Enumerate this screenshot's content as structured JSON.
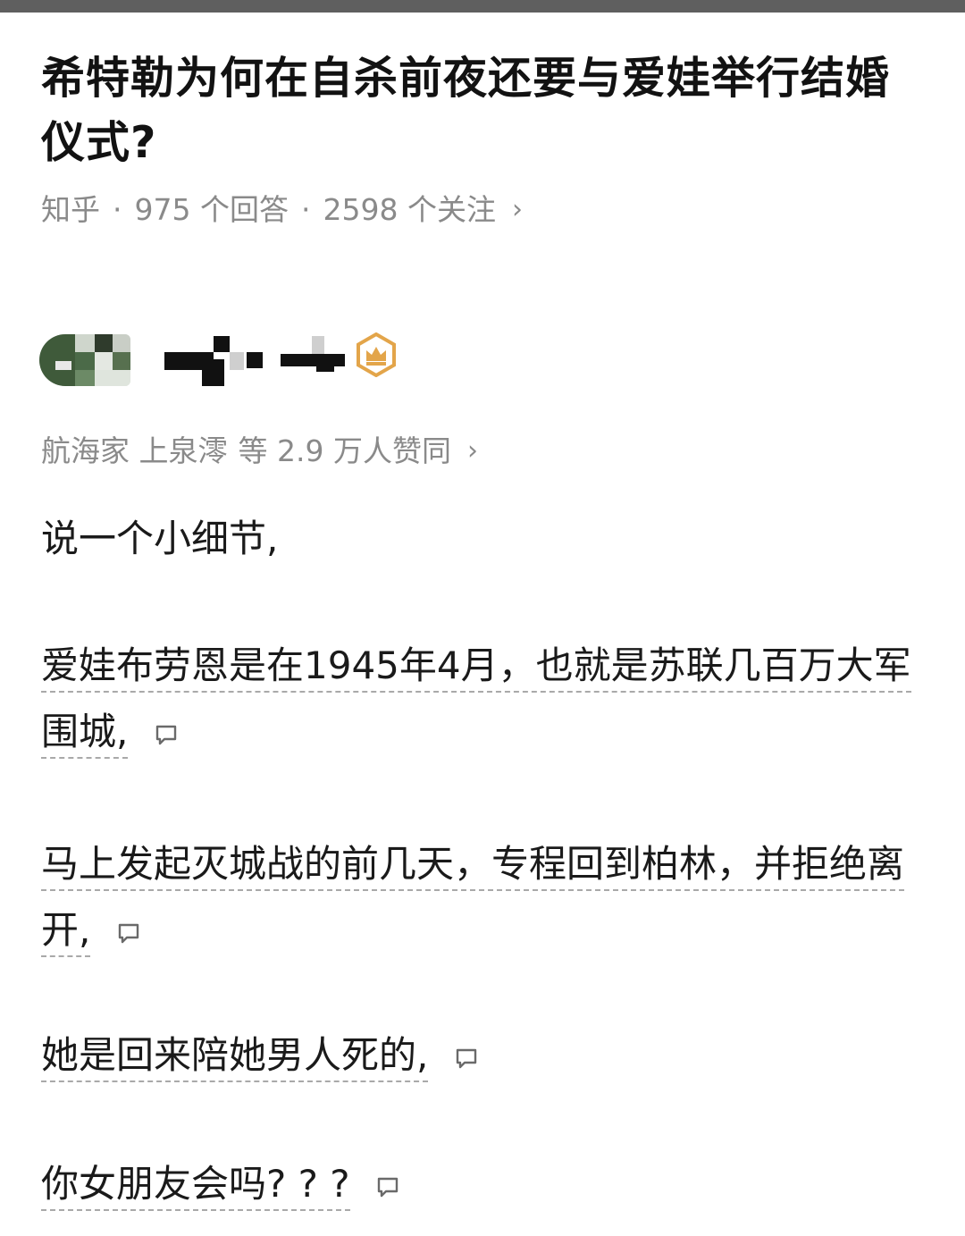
{
  "question": {
    "title": "希特勒为何在自杀前夜还要与爱娃举行结婚仪式?",
    "source": "知乎",
    "answers": "975 个回答",
    "followers": "2598 个关注"
  },
  "answer": {
    "upvoters": "航海家 上泉澪",
    "upvote_count": "等 2.9 万人赞同",
    "paragraphs": [
      "说一个小细节,",
      "爱娃布劳恩是在1945年4月，也就是苏联几百万大军围城,",
      "马上发起灭城战的前几天，专程回到柏林，并拒绝离开,",
      "她是回来陪她男人死的,",
      "你女朋友会吗? ? ?"
    ]
  },
  "colors": {
    "badge": "#e3a54a",
    "meta_text": "#8a8a8a"
  },
  "icons": [
    "chevron-right-icon",
    "crown-badge-icon",
    "comment-icon"
  ]
}
